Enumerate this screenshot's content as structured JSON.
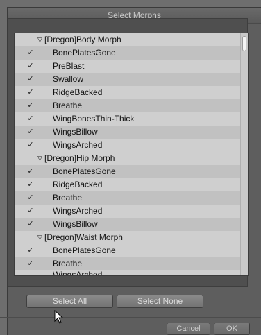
{
  "window": {
    "title": "Select Morphs"
  },
  "list": {
    "rows": [
      {
        "kind": "group",
        "label": "[Dregon]Body Morph"
      },
      {
        "kind": "item",
        "label": "BonePlatesGone",
        "checked": true
      },
      {
        "kind": "item",
        "label": "PreBlast",
        "checked": true
      },
      {
        "kind": "item",
        "label": "Swallow",
        "checked": true
      },
      {
        "kind": "item",
        "label": "RidgeBacked",
        "checked": true
      },
      {
        "kind": "item",
        "label": "Breathe",
        "checked": true
      },
      {
        "kind": "item",
        "label": "WingBonesThin-Thick",
        "checked": true
      },
      {
        "kind": "item",
        "label": "WingsBillow",
        "checked": true
      },
      {
        "kind": "item",
        "label": "WingsArched",
        "checked": true
      },
      {
        "kind": "group",
        "label": "[Dregon]Hip Morph"
      },
      {
        "kind": "item",
        "label": "BonePlatesGone",
        "checked": true
      },
      {
        "kind": "item",
        "label": "RidgeBacked",
        "checked": true
      },
      {
        "kind": "item",
        "label": "Breathe",
        "checked": true
      },
      {
        "kind": "item",
        "label": "WingsArched",
        "checked": true
      },
      {
        "kind": "item",
        "label": "WingsBillow",
        "checked": true
      },
      {
        "kind": "group",
        "label": "[Dregon]Waist Morph"
      },
      {
        "kind": "item",
        "label": "BonePlatesGone",
        "checked": true
      },
      {
        "kind": "item",
        "label": "Breathe",
        "checked": true
      },
      {
        "kind": "item",
        "label": "WingsArched",
        "checked": true
      }
    ],
    "check_glyph": "✓",
    "expand_glyph": "▽"
  },
  "buttons": {
    "select_all": "Select All",
    "select_none": "Select None",
    "cancel": "Cancel",
    "ok": "OK"
  }
}
